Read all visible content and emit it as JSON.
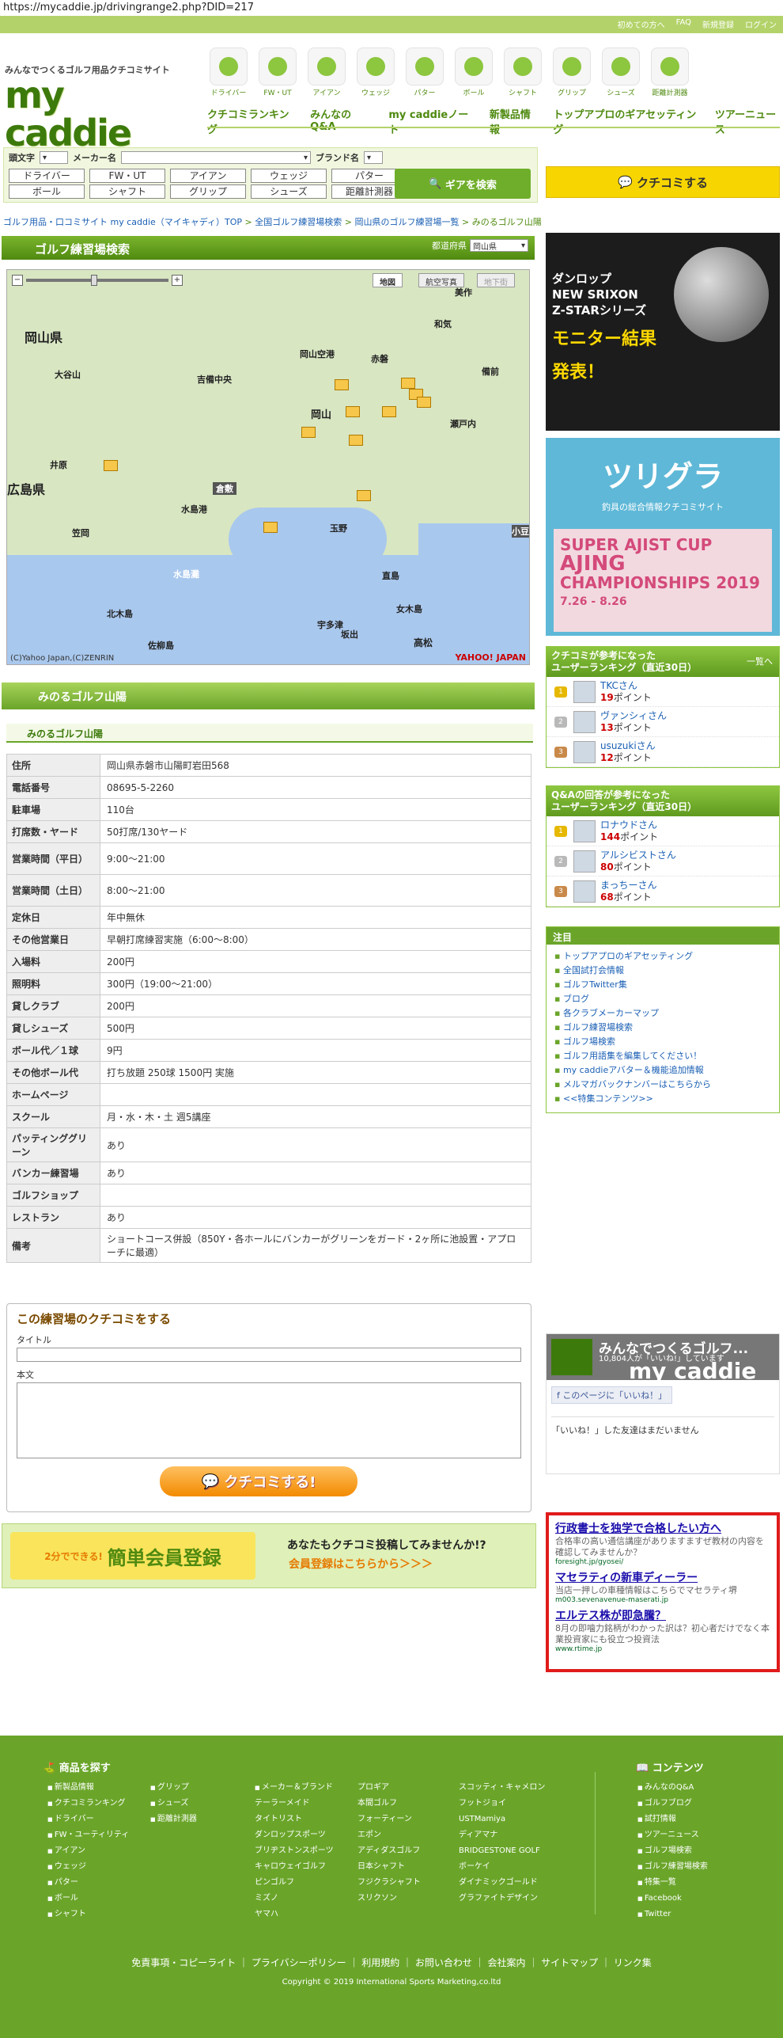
{
  "url": "https://mycaddie.jp/drivingrange2.php?DID=217",
  "header": {
    "links": [
      "初めての方へ",
      "FAQ",
      "新規登録",
      "ログイン"
    ],
    "tagline": "みんなでつくるゴルフ用品クチコミサイト",
    "logo": "my caddie",
    "categories": [
      "ドライバー",
      "FW・UT",
      "アイアン",
      "ウェッジ",
      "パター",
      "ボール",
      "シャフト",
      "グリップ",
      "シューズ",
      "距離計測器"
    ],
    "gnav": [
      "クチコミランキング",
      "みんなのQ&A",
      "my caddieノート",
      "新製品情報",
      "トップアプロのギアセッティング",
      "ツアーニュース"
    ]
  },
  "search": {
    "label_head": "頭文字",
    "label_maker": "メーカー名",
    "label_brand": "ブランド名",
    "buttons": [
      "ドライバー",
      "FW・UT",
      "アイアン",
      "ウェッジ",
      "パター",
      "ボール",
      "シャフト",
      "グリップ",
      "シューズ",
      "距離計測器"
    ],
    "submit": "ギアを検索"
  },
  "kuchikomi_button": "クチコミする",
  "breadcrumb": [
    "ゴルフ用品・口コミサイト my caddie（マイキャディ）TOP",
    "全国ゴルフ練習場検索",
    "岡山県のゴルフ練習場一覧",
    "みのるゴルフ山陽"
  ],
  "practice_search": {
    "title": "ゴルフ練習場検索",
    "pref_label": "都道府県",
    "pref_value": "岡山県"
  },
  "map": {
    "modes": [
      "地図",
      "航空写真",
      "地下街"
    ],
    "labels": [
      "岡山県",
      "広島県",
      "岡山空港",
      "吉備中央",
      "岡山",
      "倉敷",
      "玉野",
      "水島港",
      "水島灘",
      "北木島",
      "佐柳島",
      "高松",
      "小豆",
      "赤磐",
      "瀬戸内",
      "備前",
      "和気",
      "大谷山",
      "笠岡",
      "井原",
      "美作",
      "直島",
      "女木島",
      "坂出",
      "宇多津"
    ],
    "copyright": "(C)Yahoo Japan,(C)ZENRIN",
    "brand": "YAHOO! JAPAN"
  },
  "range": {
    "name": "みのるゴルフ山陽",
    "subtitle": "みのるゴルフ山陽",
    "rows": [
      {
        "k": "住所",
        "v": "岡山県赤磐市山陽町岩田568"
      },
      {
        "k": "電話番号",
        "v": "08695-5-2260"
      },
      {
        "k": "駐車場",
        "v": "110台"
      },
      {
        "k": "打席数・ヤード",
        "v": "50打席/130ヤード"
      },
      {
        "k": "営業時間（平日）",
        "v": "9:00〜21:00"
      },
      {
        "k": "営業時間（土日）",
        "v": "8:00〜21:00"
      },
      {
        "k": "定休日",
        "v": "年中無休"
      },
      {
        "k": "その他営業日",
        "v": "早朝打席練習実施（6:00〜8:00）"
      },
      {
        "k": "入場料",
        "v": "200円"
      },
      {
        "k": "照明料",
        "v": "300円（19:00〜21:00）"
      },
      {
        "k": "貸しクラブ",
        "v": "200円"
      },
      {
        "k": "貸しシューズ",
        "v": "500円"
      },
      {
        "k": "ボール代／１球",
        "v": "9円"
      },
      {
        "k": "その他ボール代",
        "v": "打ち放題 250球 1500円 実施"
      },
      {
        "k": "ホームページ",
        "v": ""
      },
      {
        "k": "スクール",
        "v": "月・水・木・土 週5講座"
      },
      {
        "k": "パッティンググリーン",
        "v": "あり"
      },
      {
        "k": "バンカー練習場",
        "v": "あり"
      },
      {
        "k": "ゴルフショップ",
        "v": ""
      },
      {
        "k": "レストラン",
        "v": "あり"
      },
      {
        "k": "備考",
        "v": "ショートコース併設（850Y・各ホールにバンカーがグリーンをガード・2ヶ所に池設置・アプローチに最適）"
      }
    ]
  },
  "review_form": {
    "title": "この練習場のクチコミをする",
    "title_label": "タイトル",
    "body_label": "本文",
    "submit": "クチコミする!"
  },
  "register_banner": {
    "badge": "2分でできる!",
    "main": "簡単会員登録",
    "line1": "あなたもクチコミ投稿してみませんか!?",
    "line2": "会員登録はこちらから＞＞＞"
  },
  "ad1": {
    "line1": "ダンロップ",
    "line2": "NEW SRIXON",
    "line3": "Z-STARシリーズ",
    "line4": "モニター結果",
    "line5": "発表！"
  },
  "ad2": {
    "title": "ツリグラ",
    "sub": "釣具の総合情報クチコミサイト",
    "event1": "SUPER AJIST CUP",
    "event2": "AJING",
    "event3": "CHAMPIONSHIPS 2019",
    "dates": "7.26 - 8.26"
  },
  "ranking_kuchikomi": {
    "title1": "クチコミが参考になった",
    "title2": "ユーザーランキング（直近30日）",
    "more": "一覧へ",
    "items": [
      {
        "rank": "1",
        "name": "TKCさん",
        "points": "19",
        "unit": "ポイント"
      },
      {
        "rank": "2",
        "name": "ヴァンシィさん",
        "points": "13",
        "unit": "ポイント"
      },
      {
        "rank": "3",
        "name": "usuzukiさん",
        "points": "12",
        "unit": "ポイント"
      }
    ]
  },
  "ranking_qa": {
    "title1": "Q&Aの回答が参考になった",
    "title2": "ユーザーランキング（直近30日）",
    "items": [
      {
        "rank": "1",
        "name": "ロナウドさん",
        "points": "144",
        "unit": "ポイント"
      },
      {
        "rank": "2",
        "name": "アルシビストさん",
        "points": "80",
        "unit": "ポイント"
      },
      {
        "rank": "3",
        "name": "まっちーさん",
        "points": "68",
        "unit": "ポイント"
      }
    ]
  },
  "notice": {
    "title": "注目",
    "items": [
      "トップアプロのギアセッティング",
      "全国試打会情報",
      "ゴルフTwitter集",
      "ブログ",
      "各クラブメーカーマップ",
      "ゴルフ練習場検索",
      "ゴルフ場検索",
      "ゴルフ用語集を編集してください！",
      "my caddieアバター＆機能追加情報",
      "メルマガバックナンバーはこちらから",
      "<<特集コンテンツ>>"
    ]
  },
  "facebook": {
    "name": "みんなでつくるゴルフ...",
    "likes": "10,804人が「いいね!」しています",
    "logo": "my caddie",
    "like_button": "このページに「いいね！」",
    "friends": "「いいね！」した友達はまだいません"
  },
  "ads": [
    {
      "title": "行政書士を独学で合格したい方へ",
      "desc": "合格率の高い通信講座がありますますぜ教材の内容を確認してみませんか？",
      "url": "foresight.jp/gyosei/"
    },
    {
      "title": "マセラティの新車ディーラー",
      "desc": "当店一押しの車種情報はこちらでマセラティ堺",
      "url": "m003.sevenavenue-maserati.jp"
    },
    {
      "title": "エルテス株が即急騰？",
      "desc": "8月の即噛力銘柄がわかった訳は？初心者だけでなく本業投資家にも役立つ投資法",
      "url": "www.rtime.jp"
    }
  ],
  "footer": {
    "products_title": "商品を探す",
    "col1": [
      "新製品情報",
      "クチコミランキング",
      "ドライバー",
      "FW・ユーティリティ",
      "アイアン",
      "ウェッジ",
      "パター",
      "ボール",
      "シャフト"
    ],
    "col2": [
      "グリップ",
      "シューズ",
      "距離計測器"
    ],
    "brand_title": "メーカー＆ブランド",
    "col3": [
      "テーラーメイド",
      "ダンロップスポーツ",
      "ブリヂストンスポーツ",
      "キャロウェイゴルフ",
      "ピンゴルフ",
      "ミズノ",
      "ヤマハ"
    ],
    "col3_head": "テーラーメイド",
    "brands_a": [
      "テーラーメイド",
      "タイトリスト",
      "ダンロップスポーツ",
      "ブリヂストンスポーツ",
      "キャロウェイゴルフ",
      "ピンゴルフ",
      "ミズノ",
      "ヤマハ"
    ],
    "brands_b": [
      "プロギア",
      "本間ゴルフ",
      "フォーティーン",
      "エポン",
      "アディダスゴルフ",
      "日本シャフト",
      "フジクラシャフト",
      "スリクソン"
    ],
    "brands_c": [
      "スコッティ・キャメロン",
      "フットジョイ",
      "USTMamiya",
      "ディアマナ",
      "BRIDGESTONE GOLF",
      "ボーケイ",
      "ダイナミックゴールド",
      "グラファイトデザイン"
    ],
    "content_title": "コンテンツ",
    "col5": [
      "みんなのQ&A",
      "ゴルフブログ",
      "試打情報",
      "ツアーニュース",
      "ゴルフ場検索",
      "ゴルフ練習場検索",
      "特集一覧",
      "Facebook",
      "Twitter"
    ],
    "links": "免責事項・コピーライト ｜ プライバシーポリシー ｜ 利用規約 ｜ お問い合わせ ｜ 会社案内 ｜ サイトマップ ｜ リンク集",
    "copyright": "Copyright © 2019 International Sports Marketing,co.ltd"
  }
}
